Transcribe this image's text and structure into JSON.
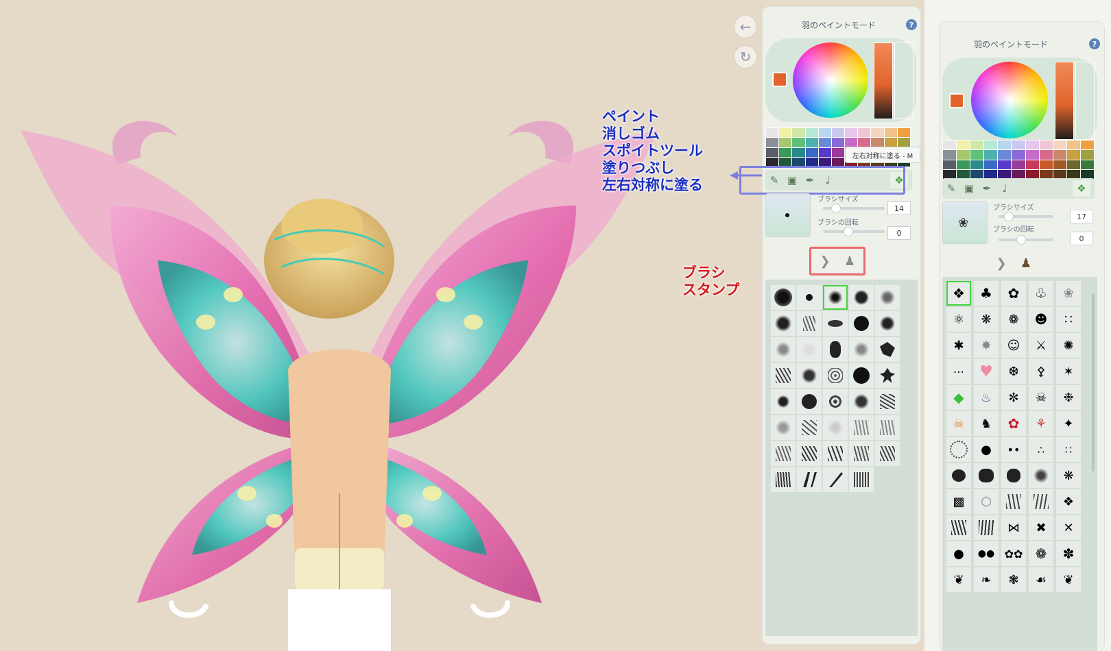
{
  "left_panel": {
    "title": "羽のペイントモード",
    "help_label": "?",
    "current_color": "#e2642c",
    "tooltip": "左右対称に塗る - M",
    "brush_size_label": "ブラシサイズ",
    "brush_size_value": "14",
    "brush_rotation_label": "ブラシの回転",
    "brush_rotation_value": "0"
  },
  "right_panel": {
    "title": "羽のペイントモード",
    "help_label": "?",
    "current_color": "#e2642c",
    "brush_size_label": "ブラシサイズ",
    "brush_size_value": "17",
    "brush_rotation_label": "ブラシの回転",
    "brush_rotation_value": "0"
  },
  "annotations": {
    "tools": [
      "ペイント",
      "消しゴム",
      "スポイトツール",
      "塗りつぶし",
      "左右対称に塗る"
    ],
    "modes": [
      "ブラシ",
      "スタンプ"
    ]
  },
  "nav": {
    "back_icon": "arrow-left-icon",
    "redo_icon": "rotate-icon"
  },
  "colors": {
    "annotation_blue": "#1a2ec0",
    "annotation_red": "#d11a1a",
    "highlight_blue": "#7b7fe0",
    "highlight_red": "#e76a6a",
    "selected_green": "#47d23f"
  }
}
